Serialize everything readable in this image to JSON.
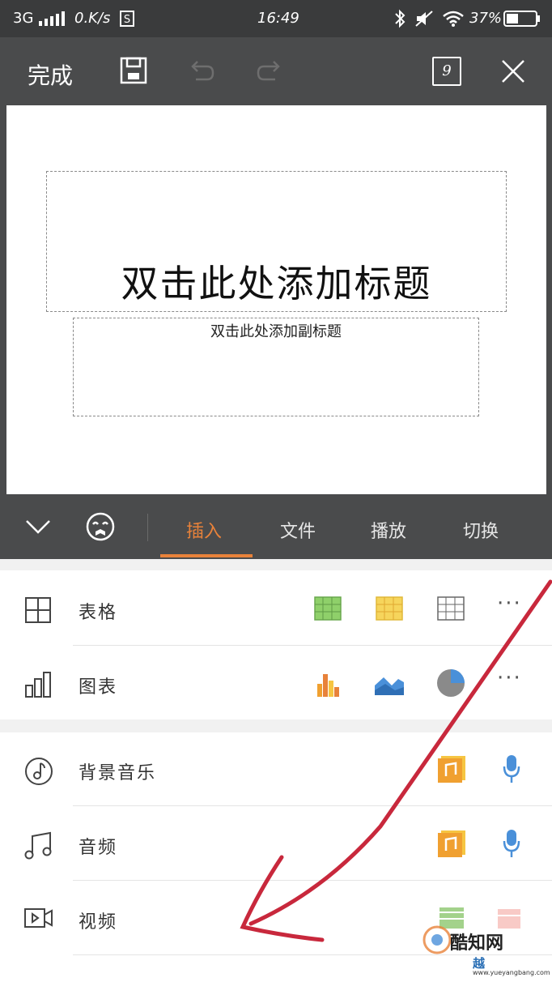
{
  "status_bar": {
    "network": "3G",
    "speed": "0.K/s",
    "time": "16:49",
    "battery": "37%"
  },
  "toolbar": {
    "done_label": "完成",
    "page_count": "9"
  },
  "slide": {
    "title_placeholder": "双击此处添加标题",
    "subtitle_placeholder": "双击此处添加副标题"
  },
  "tabs": [
    {
      "label": "插入",
      "active": true
    },
    {
      "label": "文件",
      "active": false
    },
    {
      "label": "播放",
      "active": false
    },
    {
      "label": "切换",
      "active": false
    }
  ],
  "insert_menu": {
    "table": {
      "label": "表格",
      "icon": "table-icon"
    },
    "chart": {
      "label": "图表",
      "icon": "bar-chart-icon"
    },
    "background_music": {
      "label": "背景音乐",
      "icon": "music-note-icon"
    },
    "audio": {
      "label": "音频",
      "icon": "music-icon"
    },
    "video": {
      "label": "视频",
      "icon": "video-icon"
    }
  },
  "colors": {
    "accent": "#e8823a",
    "toolbar_bg": "#4a4b4c",
    "status_bg": "#3a3b3c",
    "green_table": "#7cbf5a",
    "yellow_table": "#f4c542",
    "mic_blue": "#4a90d9",
    "music_orange": "#f0a030"
  },
  "watermark": {
    "brand": "酷知网",
    "url": "www.yueyangbang.com",
    "prefix": "越"
  }
}
